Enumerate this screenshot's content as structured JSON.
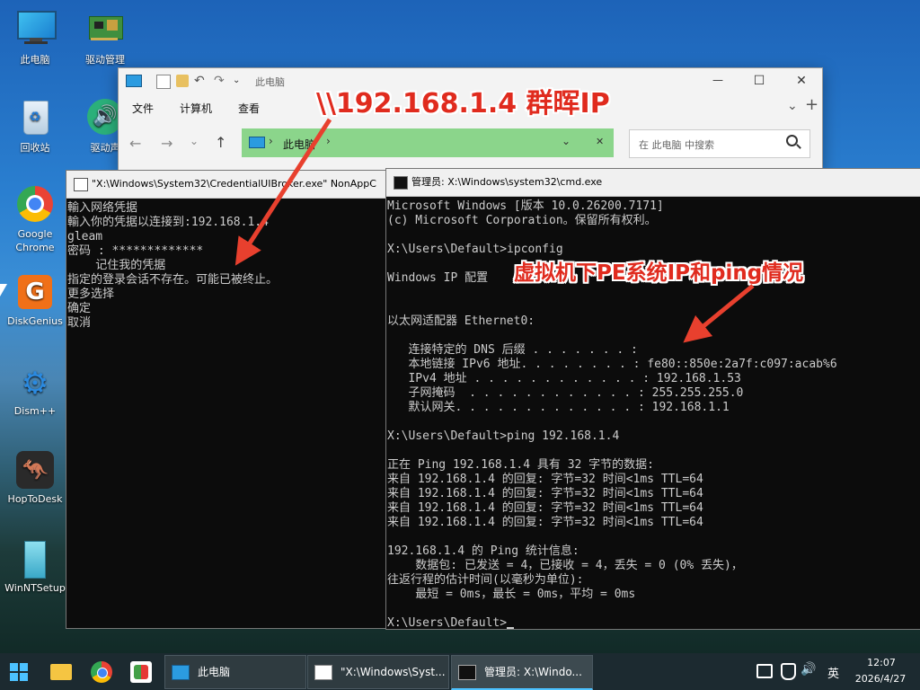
{
  "desktop": {
    "icons": [
      {
        "label": "此电脑"
      },
      {
        "label": "驱动管理"
      },
      {
        "label": "回收站"
      },
      {
        "label": "驱动声"
      },
      {
        "label": "Google Chrome"
      },
      {
        "label": "DiskGenius"
      },
      {
        "label": "Dism++"
      },
      {
        "label": "HopToDesk"
      },
      {
        "label": "WinNTSetup"
      }
    ]
  },
  "explorer": {
    "title": "此电脑",
    "menu": [
      "文件",
      "计算机",
      "查看"
    ],
    "address": "此电脑",
    "search_placeholder": "在 此电脑 中搜索",
    "close_glyph": "✕",
    "minimize_glyph": "—",
    "maximize_glyph": "☐",
    "addtab_glyph": "+"
  },
  "cred_window": {
    "title": "\"X:\\Windows\\System32\\CredentialUIBroker.exe\" NonAppC",
    "lines": [
      "輸入网络凭据",
      "輸入你的凭据以连接到:192.168.1.4",
      "gleam",
      "密码 : *************",
      "    记住我的凭据",
      "指定的登录会话不存在。可能已被终止。",
      "更多选择",
      "确定",
      "取消"
    ]
  },
  "cmd_window": {
    "title": "管理员: X:\\Windows\\system32\\cmd.exe",
    "lines": [
      "Microsoft Windows [版本 10.0.26200.7171]",
      "(c) Microsoft Corporation。保留所有权利。",
      "",
      "X:\\Users\\Default>ipconfig",
      "",
      "Windows IP 配置",
      "",
      "",
      "以太网适配器 Ethernet0:",
      "",
      "   连接特定的 DNS 后缀 . . . . . . . :",
      "   本地链接 IPv6 地址. . . . . . . . : fe80::850e:2a7f:c097:acab%6",
      "   IPv4 地址 . . . . . . . . . . . . : 192.168.1.53",
      "   子网掩码  . . . . . . . . . . . . : 255.255.255.0",
      "   默认网关. . . . . . . . . . . . . : 192.168.1.1",
      "",
      "X:\\Users\\Default>ping 192.168.1.4",
      "",
      "正在 Ping 192.168.1.4 具有 32 字节的数据:",
      "来自 192.168.1.4 的回复: 字节=32 时间<1ms TTL=64",
      "来自 192.168.1.4 的回复: 字节=32 时间<1ms TTL=64",
      "来自 192.168.1.4 的回复: 字节=32 时间<1ms TTL=64",
      "来自 192.168.1.4 的回复: 字节=32 时间<1ms TTL=64",
      "",
      "192.168.1.4 的 Ping 统计信息:",
      "    数据包: 已发送 = 4，已接收 = 4，丢失 = 0 (0% 丢失)，",
      "往返行程的估计时间(以毫秒为单位):",
      "    最短 = 0ms，最长 = 0ms，平均 = 0ms",
      "",
      "X:\\Users\\Default>"
    ]
  },
  "annotations": {
    "top": "\\\\192.168.1.4 群晖IP",
    "middle": "虚拟机下PE系统IP和ping情况",
    "color": "#e02b1e"
  },
  "taskbar": {
    "apps": [
      {
        "label": "此电脑"
      },
      {
        "label": "\"X:\\Windows\\Syst..."
      },
      {
        "label": "管理员: X:\\Windo..."
      }
    ],
    "ime": "英",
    "time": "12:07",
    "date": "2026/4/27"
  }
}
